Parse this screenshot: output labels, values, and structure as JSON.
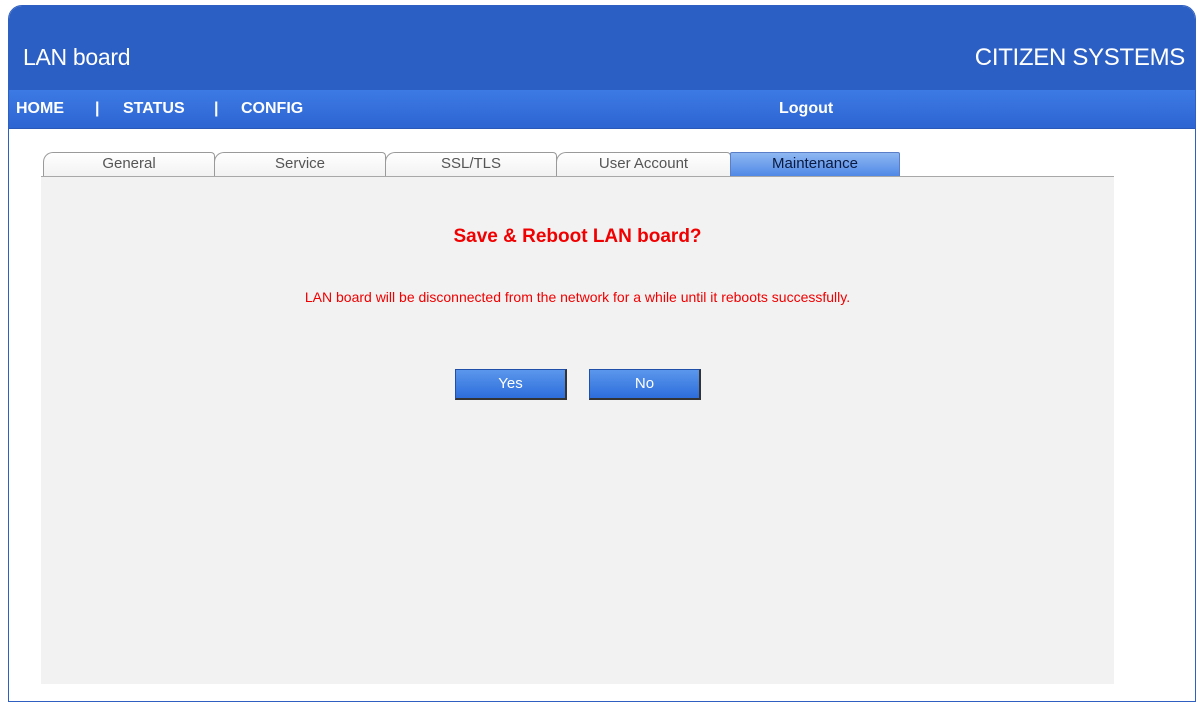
{
  "header": {
    "title": "LAN board",
    "brand": "CITIZEN SYSTEMS"
  },
  "nav": {
    "home": "HOME",
    "status": "STATUS",
    "config": "CONFIG",
    "separator": "|",
    "logout": "Logout"
  },
  "tabs": [
    {
      "label": "General"
    },
    {
      "label": "Service"
    },
    {
      "label": "SSL/TLS"
    },
    {
      "label": "User Account"
    },
    {
      "label": "Maintenance",
      "active": true
    }
  ],
  "dialog": {
    "title": "Save & Reboot LAN board?",
    "message": "LAN board will be disconnected from the network for a while until it reboots successfully.",
    "yes_label": "Yes",
    "no_label": "No"
  },
  "colors": {
    "header_bg": "#2c5fc4",
    "nav_bg": "#3d7ae4",
    "warning_text": "#f00000",
    "panel_bg": "#f2f2f2"
  }
}
